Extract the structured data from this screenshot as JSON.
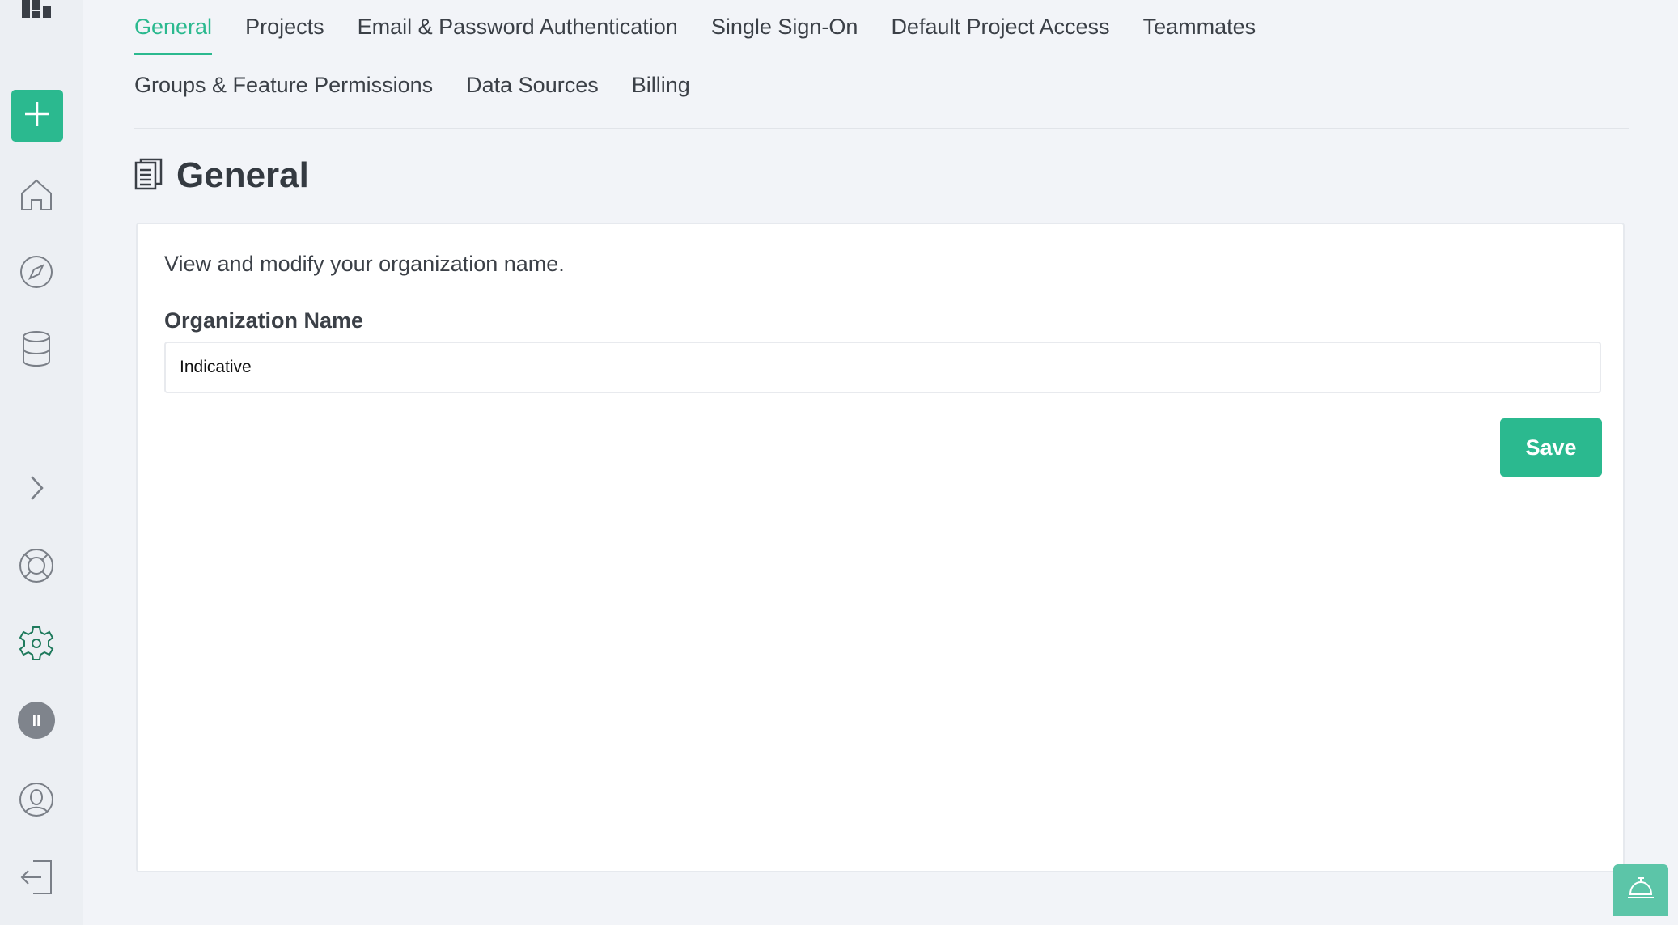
{
  "tabs_row1": [
    {
      "label": "General",
      "active": true
    },
    {
      "label": "Projects"
    },
    {
      "label": "Email & Password Authentication"
    },
    {
      "label": "Single Sign-On"
    },
    {
      "label": "Default Project Access"
    },
    {
      "label": "Teammates"
    }
  ],
  "tabs_row2": [
    {
      "label": "Groups & Feature Permissions"
    },
    {
      "label": "Data Sources"
    },
    {
      "label": "Billing"
    }
  ],
  "page": {
    "title": "General",
    "description": "View and modify your organization name."
  },
  "form": {
    "org_label": "Organization Name",
    "org_value": "Indicative",
    "save_label": "Save"
  },
  "sidebar": {
    "avatar_initials": "II"
  },
  "colors": {
    "accent": "#2bb98f",
    "settings_icon": "#1f7a5c",
    "sidebar_bg": "#eceff3"
  },
  "icons": {
    "logo": "indicative-logo",
    "add": "plus-icon",
    "home": "home-icon",
    "explore": "compass-icon",
    "data": "database-icon",
    "expand": "chevron-right-icon",
    "help": "lifebuoy-icon",
    "settings": "gear-icon",
    "profile": "user-circle-icon",
    "logout": "logout-icon",
    "page": "document-icon",
    "support": "bell-icon"
  }
}
